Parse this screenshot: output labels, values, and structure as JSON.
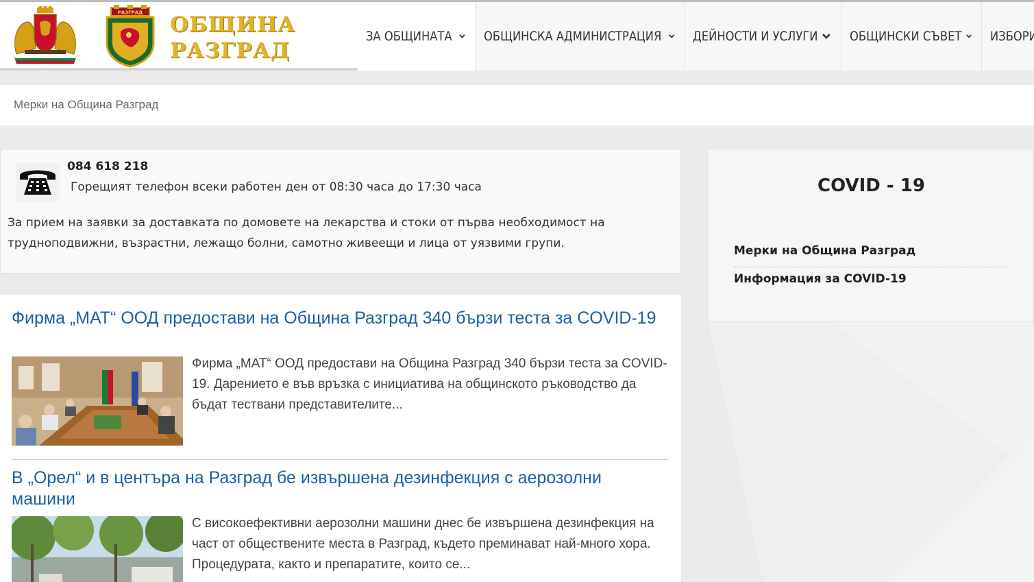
{
  "header": {
    "logo_text_line1": "ОБЩИНА",
    "logo_text_line2": "РАЗГРАД",
    "crest_banner": "РАЗГРАД",
    "nav": [
      {
        "label": "ЗА ОБЩИНАТА"
      },
      {
        "label": "ОБЩИНСКА АДМИНИСТРАЦИЯ"
      },
      {
        "label": "ДЕЙНОСТИ И УСЛУГИ"
      },
      {
        "label": "ОБЩИНСКИ СЪВЕТ"
      },
      {
        "label": "ИЗБОРИ"
      }
    ]
  },
  "breadcrumb": {
    "current": "Мерки на Община Разград"
  },
  "info": {
    "phone": "084 618 218",
    "hotline": "Горещият телефон всеки работен ден от 08:30 часа до 17:30 часа",
    "text": "За прием на заявки за доставката по домовете на лекарства и стоки от първа необходимост на трудноподвижни, възрастни, лежащо болни, самотно живеещи и лица от уязвими групи."
  },
  "articles": [
    {
      "title": "Фирма „МАТ“ ООД предостави на Община Разград 340 бързи теста за COVID-19",
      "excerpt": "Фирма „МАТ“ ООД предостави на Община Разград 340 бързи теста за COVID-19. Дарението е във връзка с инициатива на общинското ръководство да бъдат тествани представителите..."
    },
    {
      "title": "В „Орел“ и в центъра на Разград бе извършена дезинфекция с аерозолни машини",
      "excerpt": "С високоефективни аерозолни машини днес бе извършена дезинфекция на част от обществените места в Разград, където преминават най-много хора. Процедурата, както и препаратите, които се..."
    }
  ],
  "sidebar": {
    "title": "COVID - 19",
    "links": [
      {
        "label": "Мерки на Община Разград"
      },
      {
        "label": "Информация за COVID-19"
      }
    ]
  },
  "colors": {
    "link_blue": "#1f5fa0",
    "logo_gold": "#e3b22a",
    "page_bg": "#ebebeb"
  },
  "icons": [
    "bulgaria-coat-of-arms-icon",
    "razgrad-crest-icon",
    "chevron-down-icon",
    "telephone-icon"
  ]
}
